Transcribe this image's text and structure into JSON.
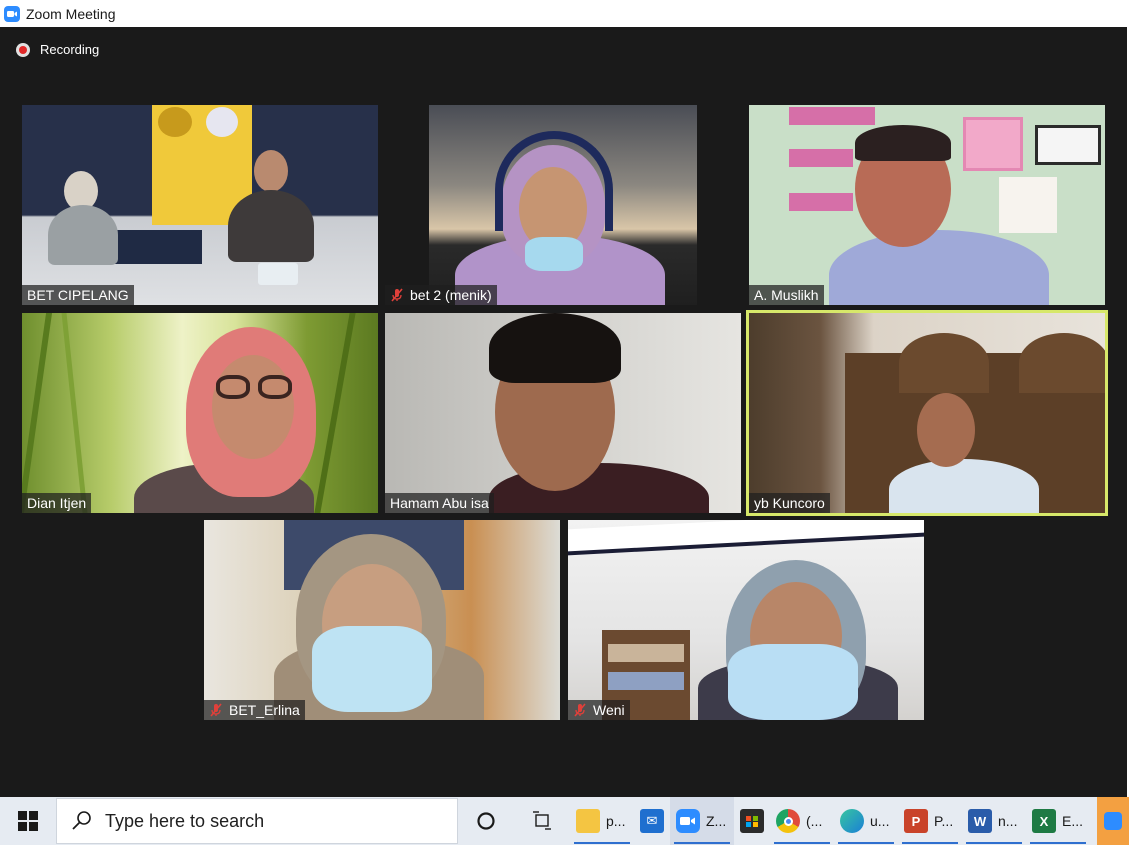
{
  "window": {
    "title": "Zoom Meeting"
  },
  "recording": {
    "label": "Recording"
  },
  "participants": [
    {
      "name": "BET CIPELANG",
      "muted": false,
      "active": false
    },
    {
      "name": "bet 2 (menik)",
      "muted": true,
      "active": false
    },
    {
      "name": "A. Muslikh",
      "muted": false,
      "active": false
    },
    {
      "name": "Dian Itjen",
      "muted": false,
      "active": false
    },
    {
      "name": "Hamam Abu isa",
      "muted": false,
      "active": false
    },
    {
      "name": "yb Kuncoro",
      "muted": false,
      "active": true
    },
    {
      "name": "BET_Erlina",
      "muted": true,
      "active": false
    },
    {
      "name": "Weni",
      "muted": true,
      "active": false
    }
  ],
  "taskbar": {
    "search_placeholder": "Type here to search",
    "apps": [
      {
        "icon": "file-explorer-icon",
        "label": "p...",
        "color": "#f4c542"
      },
      {
        "icon": "mail-icon",
        "label": "",
        "color": "#1f6fcf"
      },
      {
        "icon": "zoom-icon",
        "label": "Z...",
        "color": "#2d8cff"
      },
      {
        "icon": "store-icon",
        "label": "",
        "color": "#2b2b2b"
      },
      {
        "icon": "chrome-icon",
        "label": "(...",
        "color": "#e04b3a"
      },
      {
        "icon": "edge-icon",
        "label": "u...",
        "color": "#1a9ad6"
      },
      {
        "icon": "powerpoint-icon",
        "label": "P...",
        "color": "#c9432a"
      },
      {
        "icon": "word-icon",
        "label": "n...",
        "color": "#2a5caa"
      },
      {
        "icon": "excel-icon",
        "label": "E...",
        "color": "#1e7a44"
      }
    ]
  }
}
